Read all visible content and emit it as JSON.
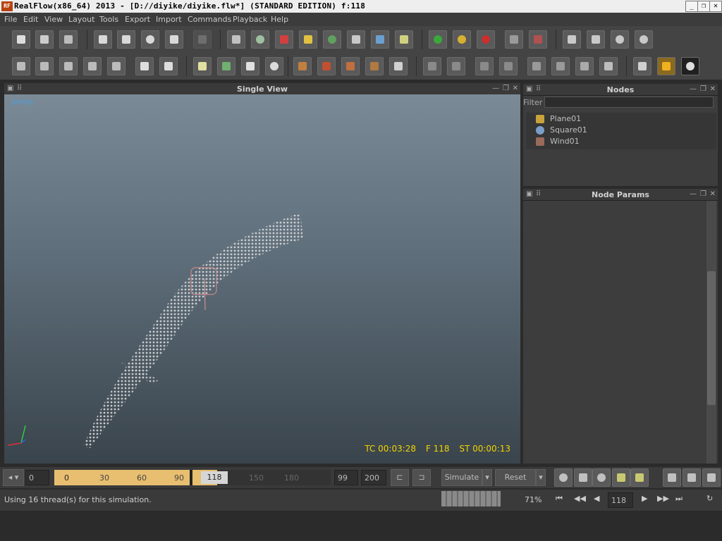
{
  "window": {
    "title": "RealFlow(x86_64) 2013 - [D://diyike/diyike.flw*] (STANDARD EDITION) f:118",
    "logo_text": "RF"
  },
  "menu": [
    "File",
    "Edit",
    "View",
    "Layout",
    "Tools",
    "Export",
    "Import",
    "Commands",
    "Playback",
    "Help"
  ],
  "toolbar1_icons": [
    "new-scene-icon",
    "open-scene-icon",
    "save-scene-icon",
    "select-icon",
    "move-icon",
    "rotate-icon",
    "scale-icon",
    "link-icon",
    "daemon-icon",
    "particles-icon",
    "emitter-icon",
    "object-icon",
    "mesh-icon",
    "camera-icon",
    "wave-icon",
    "rigid-icon",
    "green-sim-icon",
    "yellow-sim-icon",
    "red-sim-icon",
    "export-icon",
    "reset-export-icon",
    "batch-1-icon",
    "batch-2-icon",
    "batch-3-icon",
    "batch-4-icon"
  ],
  "toolbar2_icons": [
    "obj-a-icon",
    "obj-b-icon",
    "obj-c-icon",
    "obj-d-icon",
    "obj-e-icon",
    "obj-f-icon",
    "obj-g-icon",
    "notes-icon",
    "graph-icon",
    "ruler-icon",
    "dots-icon",
    "pattern-a-icon",
    "pattern-b-icon",
    "pattern-c-icon",
    "pattern-d-icon",
    "hourglass-icon",
    "cube-a-icon",
    "cube-b-icon",
    "cube-c-icon",
    "cube-d-icon",
    "cube-e-icon",
    "cube-f-icon",
    "cube-g-icon",
    "cube-h-icon",
    "render-icon",
    "fire-icon",
    "smoke-icon"
  ],
  "viewport": {
    "title": "Single View",
    "camera_label": "persp",
    "hud": {
      "tc": "TC 00:03:28",
      "frame": "F 118",
      "st": "ST 00:00:13"
    }
  },
  "nodes_panel": {
    "title": "Nodes",
    "filter_label": "Filter",
    "filter_value": "",
    "items": [
      {
        "label": "Plane01",
        "color": "#c8a23a"
      },
      {
        "label": "Square01",
        "color": "#7a9fc9"
      },
      {
        "label": "Wind01",
        "color": "#9a6a5a"
      }
    ]
  },
  "params_panel": {
    "title": "Node Params"
  },
  "timeline": {
    "start_field": "0",
    "ticks": [
      "0",
      "30",
      "60",
      "90",
      "150",
      "180"
    ],
    "current": "118",
    "end_a": "99",
    "end_b": "200",
    "progress": 0.59,
    "simulate_label": "Simulate",
    "reset_label": "Reset"
  },
  "status": {
    "message": "Using 16 thread(s) for this simulation.",
    "percent": "71%",
    "frame_field": "118"
  },
  "colors": {
    "accent": "#e8bf70",
    "hud": "#f2d400",
    "persp": "#4e9fd6"
  }
}
